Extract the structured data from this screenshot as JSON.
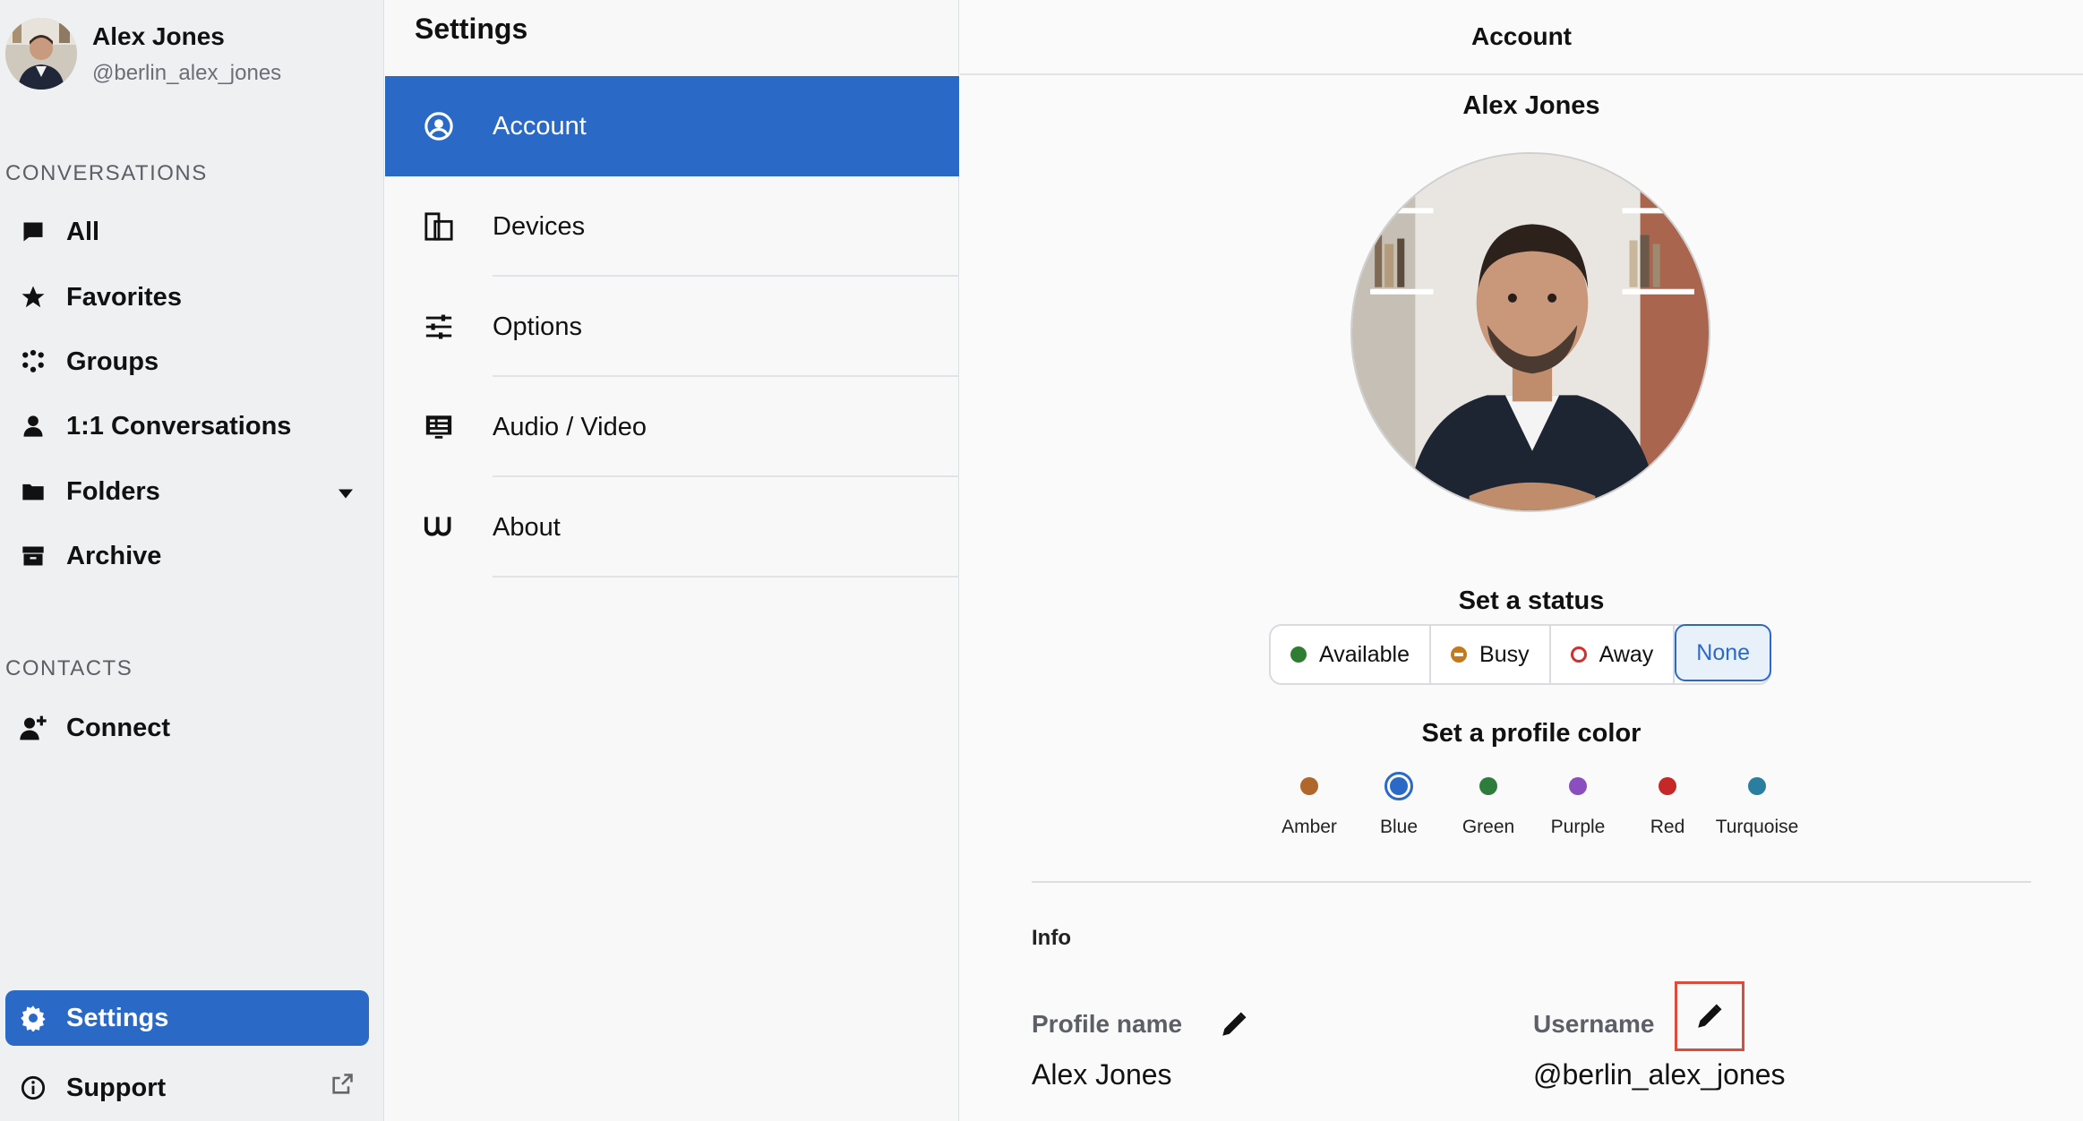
{
  "user": {
    "name": "Alex Jones",
    "handle": "@berlin_alex_jones"
  },
  "sidebar": {
    "conversations_label": "CONVERSATIONS",
    "items": [
      {
        "label": "All",
        "icon": "chat-icon"
      },
      {
        "label": "Favorites",
        "icon": "star-icon"
      },
      {
        "label": "Groups",
        "icon": "groups-icon"
      },
      {
        "label": "1:1 Conversations",
        "icon": "person-icon"
      },
      {
        "label": "Folders",
        "icon": "folder-icon"
      },
      {
        "label": "Archive",
        "icon": "archive-icon"
      }
    ],
    "contacts_label": "CONTACTS",
    "connect_label": "Connect",
    "settings_label": "Settings",
    "support_label": "Support"
  },
  "settings_menu": {
    "title": "Settings",
    "items": [
      {
        "label": "Account",
        "icon": "account-icon"
      },
      {
        "label": "Devices",
        "icon": "devices-icon"
      },
      {
        "label": "Options",
        "icon": "sliders-icon"
      },
      {
        "label": "Audio / Video",
        "icon": "audio-video-icon"
      },
      {
        "label": "About",
        "icon": "wire-logo-icon"
      }
    ]
  },
  "account": {
    "header": "Account",
    "profile_name": "Alex Jones",
    "status_title": "Set a status",
    "statuses": [
      {
        "label": "Available",
        "color": "#2e7d32"
      },
      {
        "label": "Busy",
        "color": "#c47a1c"
      },
      {
        "label": "Away",
        "color": "#d32f2f"
      },
      {
        "label": "None",
        "color": ""
      }
    ],
    "selected_status": "None",
    "color_title": "Set a profile color",
    "colors": [
      {
        "label": "Amber",
        "hex": "#b0672b"
      },
      {
        "label": "Blue",
        "hex": "#2a6ac6"
      },
      {
        "label": "Green",
        "hex": "#2e7d3c"
      },
      {
        "label": "Purple",
        "hex": "#8a4fbf"
      },
      {
        "label": "Red",
        "hex": "#c62828"
      },
      {
        "label": "Turquoise",
        "hex": "#2a7fa0"
      }
    ],
    "selected_color": "Blue",
    "info_title": "Info",
    "profile_name_label": "Profile name",
    "profile_name_value": "Alex Jones",
    "username_label": "Username",
    "username_value": "@berlin_alex_jones"
  }
}
